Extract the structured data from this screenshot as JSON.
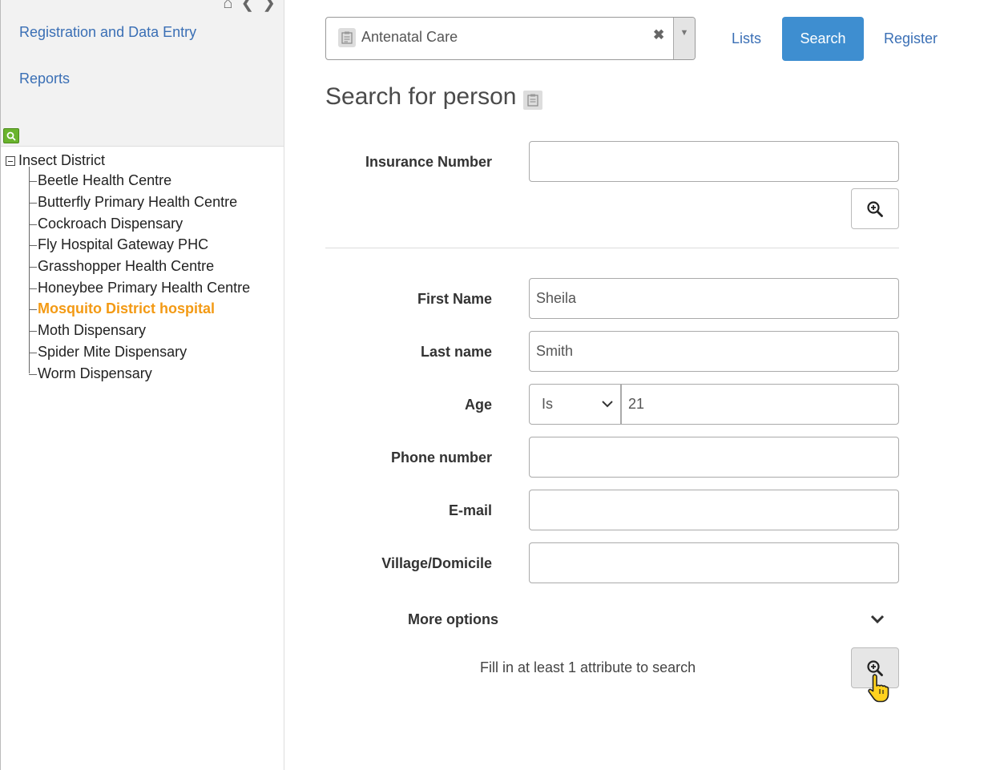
{
  "sidebar": {
    "menu": [
      "Registration and Data Entry",
      "Reports"
    ],
    "tree": {
      "root": "Insect District",
      "items": [
        "Beetle Health Centre",
        "Butterfly Primary Health Centre",
        "Cockroach Dispensary",
        "Fly Hospital Gateway PHC",
        "Grasshopper Health Centre",
        "Honeybee Primary Health Centre",
        "Mosquito District hospital",
        "Moth Dispensary",
        "Spider Mite Dispensary",
        "Worm Dispensary"
      ],
      "selected": "Mosquito District hospital"
    }
  },
  "header": {
    "program": "Antenatal Care",
    "links": {
      "lists": "Lists",
      "search": "Search",
      "register": "Register"
    }
  },
  "page": {
    "title": "Search for person"
  },
  "form": {
    "insurance": {
      "label": "Insurance Number",
      "value": ""
    },
    "first_name": {
      "label": "First Name",
      "value": "Sheila"
    },
    "last_name": {
      "label": "Last name",
      "value": "Smith"
    },
    "age": {
      "label": "Age",
      "operator": "Is",
      "value": "21"
    },
    "phone": {
      "label": "Phone number",
      "value": ""
    },
    "email": {
      "label": "E-mail",
      "value": ""
    },
    "village": {
      "label": "Village/Domicile",
      "value": ""
    },
    "more_options": "More options",
    "hint": "Fill in at least 1 attribute to search"
  },
  "icons": {
    "home": "home-icon",
    "back": "arrow-left-icon",
    "forward": "arrow-right-icon",
    "zoom": "zoom-in-icon",
    "chevron": "chevron-down-icon",
    "cursor": "hand-pointer-icon"
  },
  "colors": {
    "accent": "#3e8ed0",
    "link": "#3a6fb5",
    "selected": "#f39a14",
    "tree_search": "#6ab42d"
  }
}
